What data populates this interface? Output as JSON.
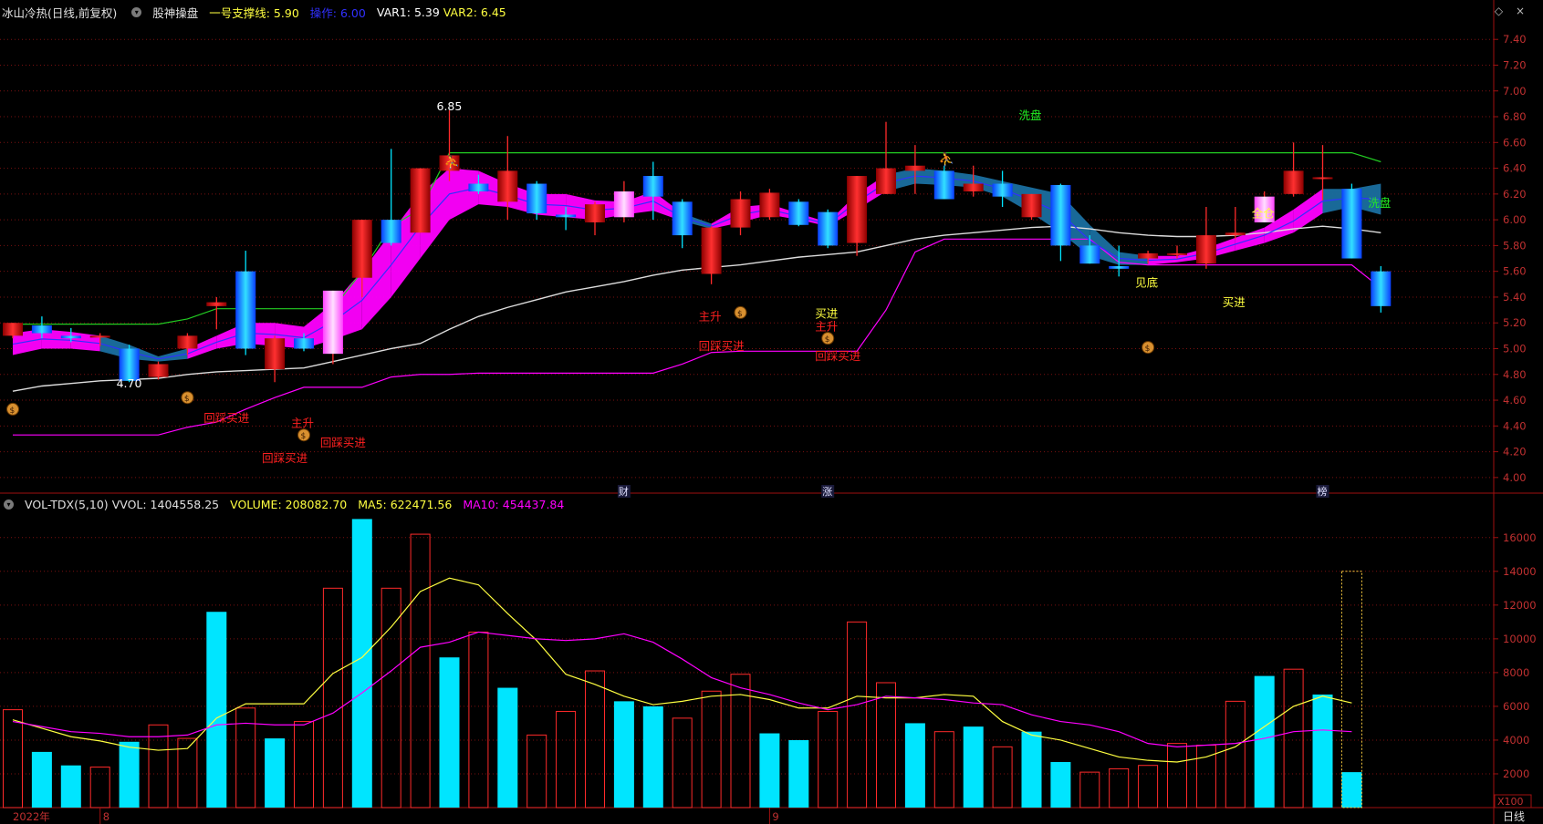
{
  "price_header": {
    "title": "冰山冷热(日线,前复权)",
    "indicator": "股神操盘",
    "support_label": "一号支撑线: 5.90",
    "operate_label": "操作: 6.00",
    "var1_label": "VAR1: 5.39",
    "var2_label": "VAR2: 6.45"
  },
  "volume_header": {
    "title": "VOL-TDX(5,10)",
    "vvol_label": "VVOL: 1404558.25",
    "volume_label": "VOLUME: 208082.70",
    "ma5_label": "MA5: 622471.56",
    "ma10_label": "MA10: 454437.84"
  },
  "window_buttons": {
    "restore": "◇",
    "close": "×"
  },
  "bottom_bar": {
    "period_label": "日线",
    "multiplier_label": "X100"
  },
  "colors": {
    "up": "#ff2a2a",
    "down": "#00e5ff",
    "ma_white": "#dddddd",
    "ma_magenta": "#ff00ff",
    "support_green": "#22cc22",
    "signal_red": "#ff2020",
    "signal_yellow": "#ffff40",
    "fill_magenta": "#ff00ff",
    "fill_blue": "#1a6fa0",
    "grid": "#7a1010",
    "axis_text": "#c03030"
  },
  "chart_data": [
    {
      "type": "candlestick",
      "title": "冰山冷热(日线,前复权)",
      "ylim": [
        3.9,
        7.55
      ],
      "yticks": [
        "4.00",
        "4.20",
        "4.40",
        "4.60",
        "4.80",
        "5.00",
        "5.20",
        "5.40",
        "5.60",
        "5.80",
        "6.00",
        "6.20",
        "6.40",
        "6.60",
        "6.80",
        "7.00",
        "7.20",
        "7.40"
      ],
      "grid": true,
      "candles": [
        {
          "o": 5.1,
          "h": 5.2,
          "l": 5.08,
          "c": 5.2
        },
        {
          "o": 5.18,
          "h": 5.25,
          "l": 5.08,
          "c": 5.12
        },
        {
          "o": 5.1,
          "h": 5.16,
          "l": 5.05,
          "c": 5.08
        },
        {
          "o": 5.1,
          "h": 5.12,
          "l": 5.02,
          "c": 5.1
        },
        {
          "o": 5.0,
          "h": 5.03,
          "l": 4.74,
          "c": 4.75
        },
        {
          "o": 4.78,
          "h": 4.9,
          "l": 4.76,
          "c": 4.88
        },
        {
          "o": 5.0,
          "h": 5.12,
          "l": 4.95,
          "c": 5.1
        },
        {
          "o": 5.33,
          "h": 5.4,
          "l": 5.15,
          "c": 5.36
        },
        {
          "o": 5.6,
          "h": 5.76,
          "l": 4.95,
          "c": 5.0
        },
        {
          "o": 4.84,
          "h": 5.1,
          "l": 4.74,
          "c": 5.08
        },
        {
          "o": 5.08,
          "h": 5.12,
          "l": 4.98,
          "c": 5.0
        },
        {
          "o": 4.96,
          "h": 5.45,
          "l": 4.88,
          "c": 5.45
        },
        {
          "o": 5.55,
          "h": 6.0,
          "l": 5.4,
          "c": 6.0
        },
        {
          "o": 6.0,
          "h": 6.55,
          "l": 5.8,
          "c": 5.82
        },
        {
          "o": 5.9,
          "h": 6.4,
          "l": 5.9,
          "c": 6.4
        },
        {
          "o": 6.38,
          "h": 6.85,
          "l": 6.3,
          "c": 6.5
        },
        {
          "o": 6.28,
          "h": 6.35,
          "l": 6.2,
          "c": 6.22
        },
        {
          "o": 6.14,
          "h": 6.65,
          "l": 6.0,
          "c": 6.38
        },
        {
          "o": 6.28,
          "h": 6.3,
          "l": 6.0,
          "c": 6.05
        },
        {
          "o": 6.04,
          "h": 6.1,
          "l": 5.92,
          "c": 6.02
        },
        {
          "o": 5.98,
          "h": 6.14,
          "l": 5.88,
          "c": 6.12
        },
        {
          "o": 6.02,
          "h": 6.3,
          "l": 5.98,
          "c": 6.22
        },
        {
          "o": 6.34,
          "h": 6.45,
          "l": 6.0,
          "c": 6.18
        },
        {
          "o": 6.14,
          "h": 6.16,
          "l": 5.78,
          "c": 5.88
        },
        {
          "o": 5.58,
          "h": 5.95,
          "l": 5.5,
          "c": 5.94
        },
        {
          "o": 5.94,
          "h": 6.22,
          "l": 5.88,
          "c": 6.16
        },
        {
          "o": 6.02,
          "h": 6.24,
          "l": 6.0,
          "c": 6.21
        },
        {
          "o": 6.14,
          "h": 6.16,
          "l": 5.95,
          "c": 5.96
        },
        {
          "o": 6.06,
          "h": 6.08,
          "l": 5.78,
          "c": 5.8
        },
        {
          "o": 5.82,
          "h": 6.34,
          "l": 5.72,
          "c": 6.34
        },
        {
          "o": 6.2,
          "h": 6.76,
          "l": 6.2,
          "c": 6.4
        },
        {
          "o": 6.38,
          "h": 6.58,
          "l": 6.2,
          "c": 6.42
        },
        {
          "o": 6.38,
          "h": 6.42,
          "l": 6.16,
          "c": 6.16
        },
        {
          "o": 6.22,
          "h": 6.42,
          "l": 6.18,
          "c": 6.28
        },
        {
          "o": 6.28,
          "h": 6.38,
          "l": 6.1,
          "c": 6.18
        },
        {
          "o": 6.02,
          "h": 6.2,
          "l": 6.0,
          "c": 6.2
        },
        {
          "o": 6.27,
          "h": 6.28,
          "l": 5.68,
          "c": 5.8
        },
        {
          "o": 5.8,
          "h": 5.88,
          "l": 5.66,
          "c": 5.66
        },
        {
          "o": 5.64,
          "h": 5.8,
          "l": 5.56,
          "c": 5.62
        },
        {
          "o": 5.7,
          "h": 5.76,
          "l": 5.66,
          "c": 5.74
        },
        {
          "o": 5.74,
          "h": 5.8,
          "l": 5.7,
          "c": 5.74
        },
        {
          "o": 5.66,
          "h": 6.1,
          "l": 5.62,
          "c": 5.88
        },
        {
          "o": 5.88,
          "h": 6.1,
          "l": 5.85,
          "c": 5.9
        },
        {
          "o": 5.98,
          "h": 6.22,
          "l": 5.98,
          "c": 6.18
        },
        {
          "o": 6.2,
          "h": 6.6,
          "l": 6.18,
          "c": 6.38
        },
        {
          "o": 6.33,
          "h": 6.58,
          "l": 6.15,
          "c": 6.33
        },
        {
          "o": 6.24,
          "h": 6.28,
          "l": 5.7,
          "c": 5.7
        },
        {
          "o": 5.6,
          "h": 5.64,
          "l": 5.28,
          "c": 5.33
        }
      ],
      "white_ma": [
        4.67,
        4.71,
        4.73,
        4.75,
        4.76,
        4.77,
        4.8,
        4.82,
        4.83,
        4.84,
        4.85,
        4.9,
        4.95,
        5.0,
        5.04,
        5.15,
        5.25,
        5.32,
        5.38,
        5.44,
        5.48,
        5.52,
        5.57,
        5.61,
        5.63,
        5.65,
        5.68,
        5.71,
        5.73,
        5.75,
        5.8,
        5.85,
        5.88,
        5.9,
        5.92,
        5.94,
        5.95,
        5.93,
        5.9,
        5.88,
        5.87,
        5.87,
        5.88,
        5.9,
        5.93,
        5.95,
        5.93,
        5.9
      ],
      "green_support": [
        5.19,
        5.19,
        5.19,
        5.19,
        5.19,
        5.19,
        5.23,
        5.31,
        5.31,
        5.31,
        5.31,
        5.31,
        5.6,
        5.95,
        6.08,
        6.52,
        6.52,
        6.52,
        6.52,
        6.52,
        6.52,
        6.52,
        6.52,
        6.52,
        6.52,
        6.52,
        6.52,
        6.52,
        6.52,
        6.52,
        6.52,
        6.52,
        6.52,
        6.52,
        6.52,
        6.52,
        6.52,
        6.52,
        6.52,
        6.52,
        6.52,
        6.52,
        6.52,
        6.52,
        6.52,
        6.52,
        6.52,
        6.45
      ],
      "magenta_low": [
        4.33,
        4.33,
        4.33,
        4.33,
        4.33,
        4.33,
        4.39,
        4.43,
        4.53,
        4.62,
        4.7,
        4.7,
        4.7,
        4.78,
        4.8,
        4.8,
        4.81,
        4.81,
        4.81,
        4.81,
        4.81,
        4.81,
        4.81,
        4.88,
        4.97,
        4.98,
        4.98,
        4.98,
        4.98,
        4.98,
        5.3,
        5.75,
        5.85,
        5.85,
        5.85,
        5.85,
        5.85,
        5.85,
        5.67,
        5.65,
        5.65,
        5.65,
        5.65,
        5.65,
        5.65,
        5.65,
        5.65,
        5.47
      ],
      "band_upper": [
        5.12,
        5.15,
        5.13,
        5.1,
        5.03,
        4.94,
        5.0,
        5.1,
        5.2,
        5.2,
        5.17,
        5.35,
        5.6,
        5.9,
        6.2,
        6.4,
        6.38,
        6.28,
        6.2,
        6.2,
        6.15,
        6.14,
        6.22,
        6.05,
        5.97,
        6.1,
        6.12,
        6.05,
        5.98,
        6.2,
        6.35,
        6.4,
        6.38,
        6.35,
        6.3,
        6.25,
        6.2,
        5.96,
        5.75,
        5.72,
        5.72,
        5.78,
        5.86,
        5.94,
        6.08,
        6.24,
        6.24,
        6.28
      ],
      "band_lower": [
        4.95,
        5.0,
        5.0,
        4.98,
        4.92,
        4.9,
        4.92,
        5.0,
        5.04,
        5.02,
        5.0,
        5.07,
        5.15,
        5.4,
        5.7,
        6.0,
        6.12,
        6.1,
        6.04,
        6.02,
        6.0,
        6.04,
        6.07,
        5.99,
        5.93,
        5.98,
        6.04,
        6.0,
        5.95,
        6.08,
        6.22,
        6.28,
        6.27,
        6.25,
        6.18,
        6.05,
        5.9,
        5.72,
        5.65,
        5.65,
        5.67,
        5.7,
        5.76,
        5.82,
        5.9,
        6.05,
        6.1,
        6.04
      ],
      "annotations": [
        {
          "text": "6.85",
          "index": 15,
          "value": 6.85,
          "color": "#ffffff"
        },
        {
          "text": "4.70",
          "index": 4,
          "value": 4.7,
          "color": "#ffffff"
        },
        {
          "text": "洗盘",
          "index": 35,
          "value": 6.78,
          "color": "#22ee22"
        },
        {
          "text": "洗盘",
          "index": 47,
          "value": 6.1,
          "color": "#22ee22"
        },
        {
          "text": "主升",
          "index": 24,
          "value": 5.22,
          "color": "#ff2020"
        },
        {
          "text": "回踩买进",
          "index": 24,
          "value": 4.99,
          "color": "#ff2020"
        },
        {
          "text": "买进",
          "index": 28,
          "value": 5.24,
          "color": "#ffff40"
        },
        {
          "text": "主升",
          "index": 28,
          "value": 5.14,
          "color": "#ff2020"
        },
        {
          "text": "回踩买进",
          "index": 28,
          "value": 4.91,
          "color": "#ff2020"
        },
        {
          "text": "回踩买进",
          "index": 7,
          "value": 4.43,
          "color": "#ff2020"
        },
        {
          "text": "主升",
          "index": 10,
          "value": 4.39,
          "color": "#ff2020"
        },
        {
          "text": "回踩买进",
          "index": 11,
          "value": 4.24,
          "color": "#ff2020"
        },
        {
          "text": "回踩买进",
          "index": 9,
          "value": 4.12,
          "color": "#ff2020"
        },
        {
          "text": "见底",
          "index": 39,
          "value": 5.48,
          "color": "#ffff40"
        },
        {
          "text": "买进",
          "index": 42,
          "value": 5.33,
          "color": "#ffff40"
        },
        {
          "text": "全仓",
          "index": 43,
          "value": 6.02,
          "color": "#ffff40"
        }
      ],
      "money_icons": [
        [
          0,
          4.53
        ],
        [
          6,
          4.62
        ],
        [
          10,
          4.33
        ],
        [
          25,
          5.28
        ],
        [
          28,
          5.08
        ],
        [
          39,
          5.01
        ]
      ],
      "star_icons": [
        [
          15,
          6.45
        ],
        [
          32,
          6.47
        ]
      ],
      "event_markers": [
        {
          "text": "财",
          "index": 21
        },
        {
          "text": "涨",
          "index": 28
        },
        {
          "text": "榜",
          "index": 45
        }
      ]
    },
    {
      "type": "bar",
      "title": "VOL-TDX(5,10)",
      "ylim": [
        0,
        17500
      ],
      "yticks": [
        "2000",
        "4000",
        "6000",
        "8000",
        "10000",
        "12000",
        "14000",
        "16000"
      ],
      "volumes": [
        5800,
        3300,
        2500,
        2400,
        3900,
        4900,
        4100,
        11600,
        5900,
        4100,
        5100,
        13000,
        17100,
        13000,
        16200,
        8900,
        10400,
        7100,
        4300,
        5700,
        8100,
        6300,
        6000,
        5300,
        6900,
        7900,
        4400,
        4000,
        5700,
        11000,
        7400,
        5000,
        4500,
        4800,
        3600,
        4500,
        2700,
        2100,
        2300,
        2500,
        3800,
        3700,
        6300,
        7800,
        8200,
        6700,
        2100
      ],
      "up_flags": [
        1,
        0,
        0,
        1,
        0,
        1,
        1,
        0,
        1,
        0,
        1,
        1,
        0,
        1,
        1,
        0,
        1,
        0,
        1,
        1,
        1,
        0,
        0,
        1,
        1,
        1,
        0,
        0,
        1,
        1,
        1,
        0,
        1,
        0,
        1,
        0,
        0,
        1,
        1,
        1,
        1,
        1,
        1,
        0,
        1,
        0,
        0
      ],
      "ma5": [
        5200,
        4700,
        4200,
        3950,
        3580,
        3400,
        3500,
        5300,
        6150,
        6150,
        6150,
        7950,
        8900,
        10700,
        12800,
        13600,
        13200,
        11500,
        9900,
        7900,
        7300,
        6600,
        6100,
        6300,
        6600,
        6700,
        6400,
        5900,
        5900,
        6600,
        6500,
        6500,
        6700,
        6600,
        5100,
        4300,
        4000,
        3500,
        3000,
        2800,
        2700,
        3000,
        3600,
        4800,
        6000,
        6600,
        6200
      ],
      "ma10": [
        5100,
        4800,
        4500,
        4400,
        4200,
        4200,
        4300,
        4900,
        5000,
        4900,
        4900,
        5600,
        6800,
        8100,
        9500,
        9800,
        10400,
        10200,
        10000,
        9900,
        10000,
        10300,
        9800,
        8800,
        7700,
        7100,
        6700,
        6200,
        5800,
        6100,
        6600,
        6500,
        6400,
        6200,
        6100,
        5500,
        5100,
        4900,
        4500,
        3800,
        3600,
        3700,
        3800,
        4100,
        4500,
        4600,
        4500
      ]
    }
  ],
  "x_axis": {
    "year_label": "2022年",
    "month_labels": [
      {
        "text": "8",
        "index": 3
      },
      {
        "text": "9",
        "index": 26
      }
    ]
  }
}
